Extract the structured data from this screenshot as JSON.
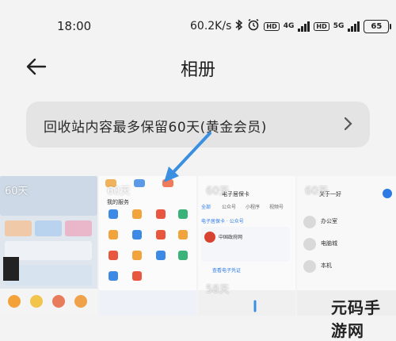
{
  "status_bar": {
    "time": "18:00",
    "speed": "60.2K/s",
    "net1": "4G",
    "net2": "5G",
    "hd_label": "HD",
    "battery": "65"
  },
  "header": {
    "title": "相册"
  },
  "notice": {
    "text": "回收站内容最多保留60天(黄金会员)"
  },
  "thumbnails": {
    "days_labels": [
      "60天",
      "60天",
      "60天",
      "60天",
      "58天"
    ],
    "t2": {
      "section_title": "我的服务"
    },
    "t3": {
      "header": "电子居保卡",
      "tabs": [
        "全部",
        "公众号",
        "小程序",
        "视频号"
      ],
      "section": "电子居保卡 · 公众号",
      "org": "中国政府网",
      "footer": "查看电子凭证"
    },
    "t4": {
      "top": "关于一好",
      "items": [
        "办公室",
        "电脑城",
        "本机"
      ]
    }
  },
  "watermark": "元码手游网"
}
